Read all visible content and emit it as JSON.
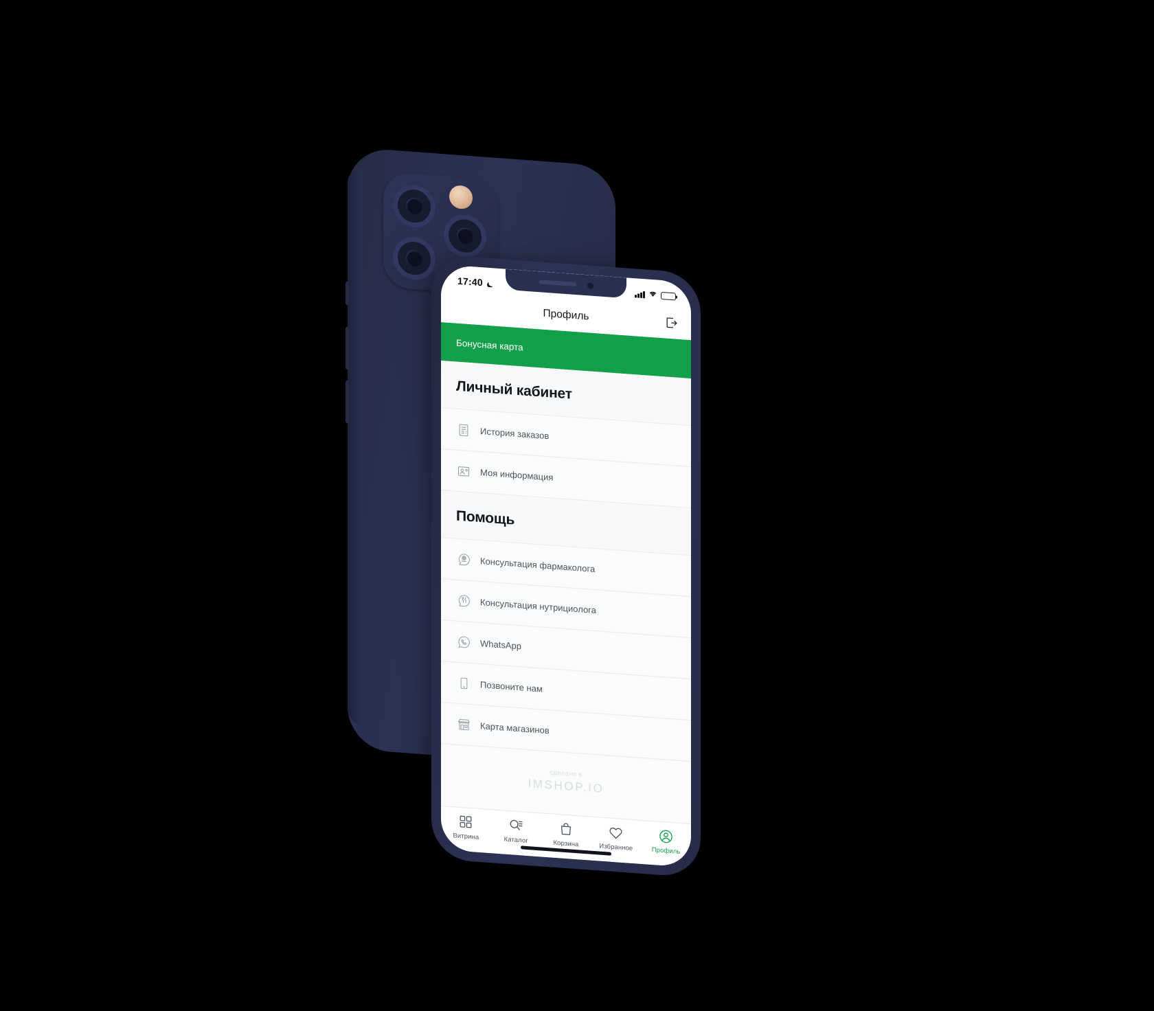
{
  "device": {
    "back_phone_label": "iphone-rear",
    "front_phone_label": "iphone-front"
  },
  "status_bar": {
    "time": "17:40",
    "moon_icon": "moon-icon",
    "signal_icon": "signal-bars-icon",
    "wifi_icon": "wifi-icon",
    "battery_icon": "battery-icon"
  },
  "navbar": {
    "title": "Профиль",
    "logout_icon": "logout-icon"
  },
  "bonus": {
    "label": "Бонусная карта"
  },
  "sections": [
    {
      "title": "Личный кабинет",
      "items": [
        {
          "label": "История заказов",
          "icon": "order-history-icon"
        },
        {
          "label": "Моя информация",
          "icon": "user-card-icon"
        }
      ]
    },
    {
      "title": "Помощь",
      "items": [
        {
          "label": "Консультация фармаколога",
          "icon": "pharmacist-chat-icon"
        },
        {
          "label": "Консультация нутрициолога",
          "icon": "nutritionist-chat-icon"
        },
        {
          "label": "WhatsApp",
          "icon": "whatsapp-icon"
        },
        {
          "label": "Позвоните нам",
          "icon": "phone-icon"
        },
        {
          "label": "Карта магазинов",
          "icon": "store-map-icon"
        }
      ]
    }
  ],
  "branding": {
    "made_in": "сделано в",
    "name": "IMSHOP.IO"
  },
  "tabbar": {
    "items": [
      {
        "label": "Витрина",
        "icon": "grid-icon",
        "active": false
      },
      {
        "label": "Каталог",
        "icon": "catalog-search-icon",
        "active": false
      },
      {
        "label": "Корзина",
        "icon": "shopping-bag-icon",
        "active": false
      },
      {
        "label": "Избранное",
        "icon": "heart-icon",
        "active": false
      },
      {
        "label": "Профиль",
        "icon": "profile-icon",
        "active": true
      }
    ]
  },
  "colors": {
    "brand_green": "#14a04a",
    "device_navy": "#2b3150",
    "background": "#000000",
    "list_text": "#4d525c"
  }
}
